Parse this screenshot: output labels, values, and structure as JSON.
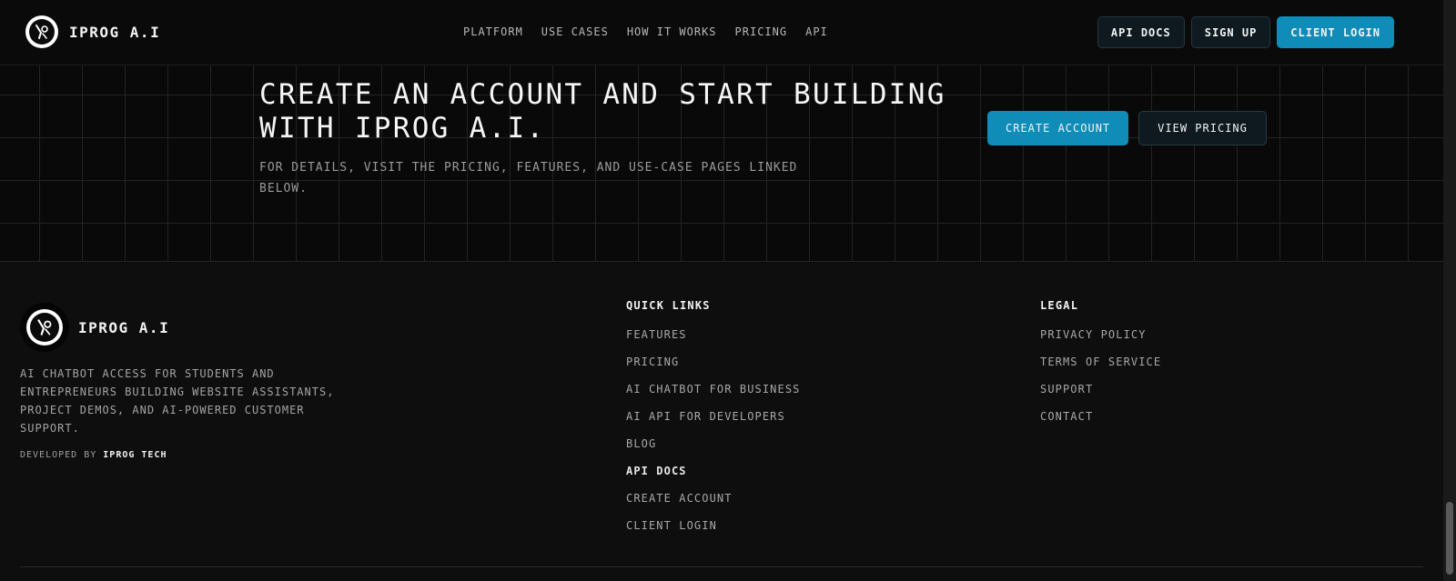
{
  "header": {
    "brand": "IPROG A.I",
    "nav": [
      "PLATFORM",
      "USE CASES",
      "HOW IT WORKS",
      "PRICING",
      "API"
    ],
    "buttons": {
      "api_docs": "API DOCS",
      "sign_up": "SIGN UP",
      "client_login": "CLIENT LOGIN"
    }
  },
  "hero": {
    "title_line1": "CREATE AN ACCOUNT AND START BUILDING",
    "title_line2": "WITH IPROG A.I.",
    "subtitle": "FOR DETAILS, VISIT THE PRICING, FEATURES, AND USE-CASE PAGES LINKED BELOW.",
    "create_account": "CREATE ACCOUNT",
    "view_pricing": "VIEW PRICING"
  },
  "footer": {
    "brand": "IPROG A.I",
    "description": "AI CHATBOT ACCESS FOR STUDENTS AND ENTREPRENEURS BUILDING WEBSITE ASSISTANTS, PROJECT DEMOS, AND AI-POWERED CUSTOMER SUPPORT.",
    "developed_by": "DEVELOPED BY",
    "developer": "IPROG TECH",
    "quick_links": {
      "title": "QUICK LINKS",
      "items": [
        "FEATURES",
        "PRICING",
        "AI CHATBOT FOR BUSINESS",
        "AI API FOR DEVELOPERS",
        "BLOG",
        "API DOCS",
        "CREATE ACCOUNT",
        "CLIENT LOGIN"
      ]
    },
    "legal": {
      "title": "LEGAL",
      "items": [
        "PRIVACY POLICY",
        "TERMS OF SERVICE",
        "SUPPORT",
        "CONTACT"
      ]
    }
  },
  "colors": {
    "accent": "#0f8db8",
    "background": "#0b0b0b"
  },
  "icons": {
    "logo": "robot-hand-logo-icon"
  }
}
